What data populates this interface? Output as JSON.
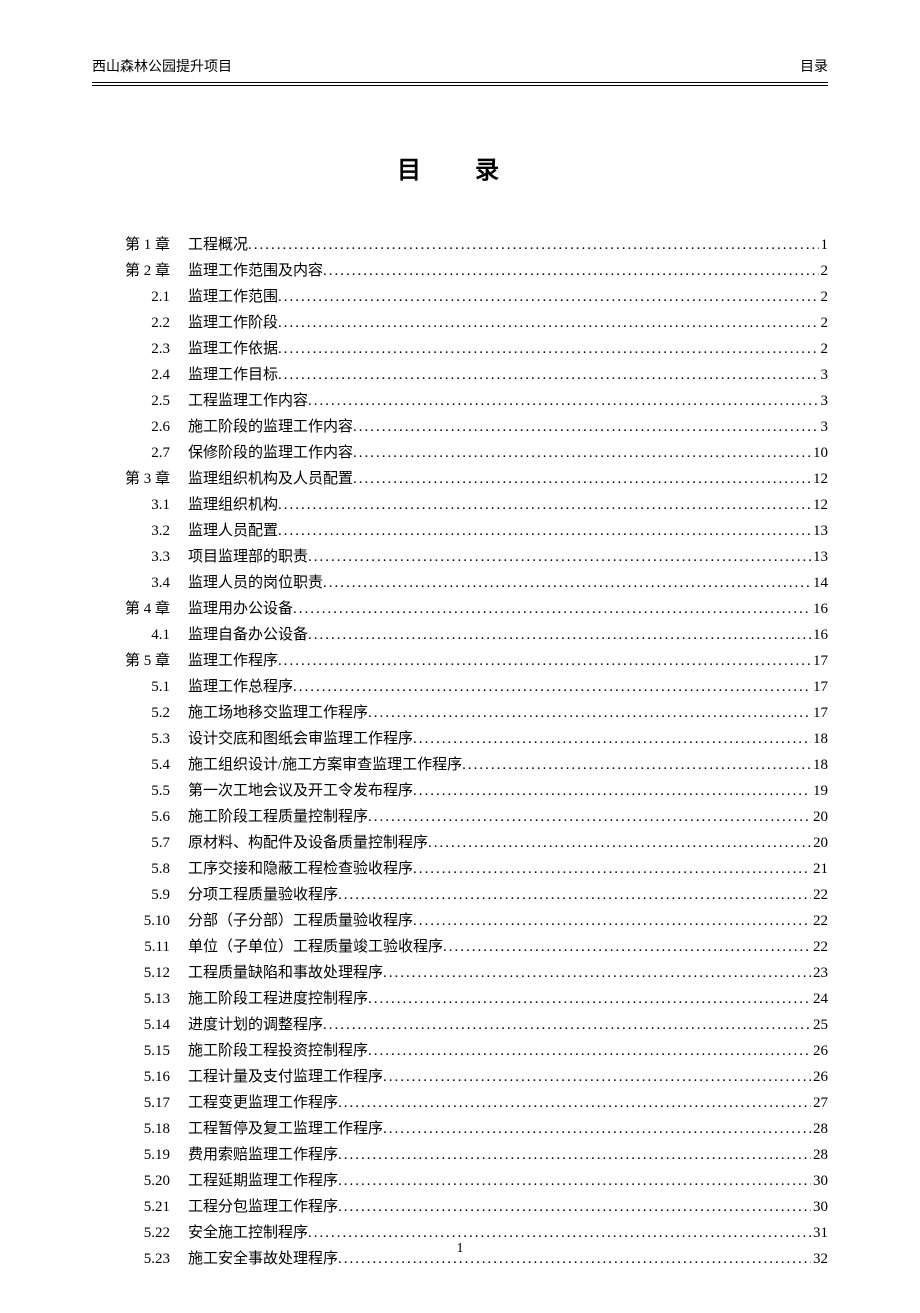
{
  "header": {
    "left": "西山森林公园提升项目",
    "right": "目录"
  },
  "title": "目 录",
  "page_number": "1",
  "toc": [
    {
      "label": "第 1 章",
      "title": "工程概况",
      "page": "1",
      "level": 1
    },
    {
      "label": "第 2 章",
      "title": "监理工作范围及内容",
      "page": "2",
      "level": 1
    },
    {
      "label": "2.1",
      "title": "监理工作范围",
      "page": "2",
      "level": 2
    },
    {
      "label": "2.2",
      "title": "监理工作阶段",
      "page": "2",
      "level": 2
    },
    {
      "label": "2.3",
      "title": "监理工作依据",
      "page": "2",
      "level": 2
    },
    {
      "label": "2.4",
      "title": "监理工作目标",
      "page": "3",
      "level": 2
    },
    {
      "label": "2.5",
      "title": "工程监理工作内容",
      "page": "3",
      "level": 2
    },
    {
      "label": "2.6",
      "title": "施工阶段的监理工作内容",
      "page": "3",
      "level": 2
    },
    {
      "label": "2.7",
      "title": "保修阶段的监理工作内容",
      "page": "10",
      "level": 2
    },
    {
      "label": "第 3 章",
      "title": "监理组织机构及人员配置",
      "page": "12",
      "level": 1
    },
    {
      "label": "3.1",
      "title": "监理组织机构",
      "page": "12",
      "level": 2
    },
    {
      "label": "3.2",
      "title": "监理人员配置",
      "page": "13",
      "level": 2
    },
    {
      "label": "3.3",
      "title": "项目监理部的职责",
      "page": "13",
      "level": 2
    },
    {
      "label": "3.4",
      "title": "监理人员的岗位职责",
      "page": "14",
      "level": 2
    },
    {
      "label": "第 4 章",
      "title": "监理用办公设备",
      "page": "16",
      "level": 1
    },
    {
      "label": "4.1",
      "title": "监理自备办公设备",
      "page": "16",
      "level": 2
    },
    {
      "label": "第 5 章",
      "title": "监理工作程序",
      "page": "17",
      "level": 1
    },
    {
      "label": "5.1",
      "title": "监理工作总程序",
      "page": "17",
      "level": 2
    },
    {
      "label": "5.2",
      "title": "施工场地移交监理工作程序",
      "page": "17",
      "level": 2
    },
    {
      "label": "5.3",
      "title": "设计交底和图纸会审监理工作程序",
      "page": "18",
      "level": 2
    },
    {
      "label": "5.4",
      "title": "施工组织设计/施工方案审查监理工作程序",
      "page": "18",
      "level": 2
    },
    {
      "label": "5.5",
      "title": "第一次工地会议及开工令发布程序",
      "page": "19",
      "level": 2
    },
    {
      "label": "5.6",
      "title": "施工阶段工程质量控制程序",
      "page": "20",
      "level": 2
    },
    {
      "label": "5.7",
      "title": "原材料、构配件及设备质量控制程序",
      "page": "20",
      "level": 2
    },
    {
      "label": "5.8",
      "title": "工序交接和隐蔽工程检查验收程序",
      "page": "21",
      "level": 2
    },
    {
      "label": "5.9",
      "title": "分项工程质量验收程序",
      "page": "22",
      "level": 2
    },
    {
      "label": "5.10",
      "title": "分部（子分部）工程质量验收程序",
      "page": "22",
      "level": 2
    },
    {
      "label": "5.11",
      "title": "单位（子单位）工程质量竣工验收程序",
      "page": "22",
      "level": 2
    },
    {
      "label": "5.12",
      "title": "工程质量缺陷和事故处理程序",
      "page": "23",
      "level": 2
    },
    {
      "label": "5.13",
      "title": "施工阶段工程进度控制程序",
      "page": "24",
      "level": 2
    },
    {
      "label": "5.14",
      "title": "进度计划的调整程序",
      "page": "25",
      "level": 2
    },
    {
      "label": "5.15",
      "title": "施工阶段工程投资控制程序",
      "page": "26",
      "level": 2
    },
    {
      "label": "5.16",
      "title": "工程计量及支付监理工作程序",
      "page": "26",
      "level": 2
    },
    {
      "label": "5.17",
      "title": "工程变更监理工作程序",
      "page": "27",
      "level": 2
    },
    {
      "label": "5.18",
      "title": "工程暂停及复工监理工作程序",
      "page": "28",
      "level": 2
    },
    {
      "label": "5.19",
      "title": "费用索赔监理工作程序",
      "page": "28",
      "level": 2
    },
    {
      "label": "5.20",
      "title": "工程延期监理工作程序",
      "page": "30",
      "level": 2
    },
    {
      "label": "5.21",
      "title": "工程分包监理工作程序",
      "page": "30",
      "level": 2
    },
    {
      "label": "5.22",
      "title": "安全施工控制程序",
      "page": "31",
      "level": 2
    },
    {
      "label": "5.23",
      "title": "施工安全事故处理程序",
      "page": "32",
      "level": 2
    }
  ]
}
